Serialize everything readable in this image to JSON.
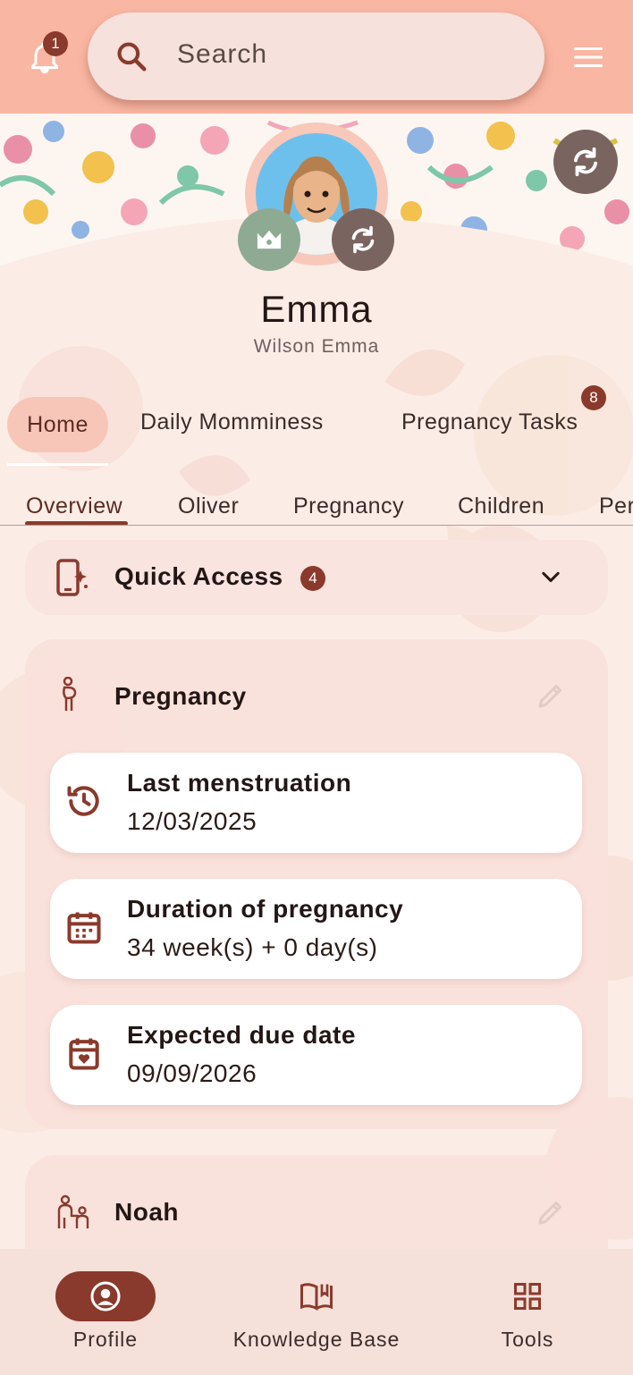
{
  "header": {
    "notification_count": "1",
    "search_placeholder": "Search"
  },
  "profile": {
    "name": "Emma",
    "subtitle": "Wilson Emma"
  },
  "primary_tabs": [
    {
      "label": "Home",
      "active": true
    },
    {
      "label": "Daily Momminess"
    },
    {
      "label": "Pregnancy Tasks",
      "badge": "8"
    }
  ],
  "secondary_tabs": [
    {
      "label": "Overview",
      "active": true
    },
    {
      "label": "Oliver"
    },
    {
      "label": "Pregnancy"
    },
    {
      "label": "Children"
    },
    {
      "label": "Per"
    }
  ],
  "quick_access": {
    "title": "Quick Access",
    "badge": "4"
  },
  "pregnancy_section": {
    "title": "Pregnancy",
    "items": [
      {
        "label": "Last menstruation",
        "value": "12/03/2025",
        "icon": "history-icon"
      },
      {
        "label": "Duration of pregnancy",
        "value": "34 week(s) + 0 day(s)",
        "icon": "calendar-icon"
      },
      {
        "label": "Expected due date",
        "value": "09/09/2026",
        "icon": "calendar-heart-icon"
      }
    ]
  },
  "child_section": {
    "title": "Noah"
  },
  "bottom_nav": [
    {
      "label": "Profile",
      "active": true
    },
    {
      "label": "Knowledge Base"
    },
    {
      "label": "Tools"
    }
  ],
  "colors": {
    "header_bg": "#f9b6a2",
    "accent": "#8a3a2c",
    "card_bg": "#f9e4df",
    "crown_button": "#8faa93",
    "sync_button": "#7a6460"
  }
}
